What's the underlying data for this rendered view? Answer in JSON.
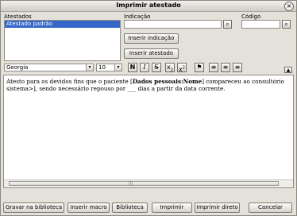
{
  "window": {
    "title": "Imprimir atestado"
  },
  "atestados": {
    "label": "Atestados",
    "items": [
      "Atestado padrão"
    ]
  },
  "indicacao": {
    "label": "Indicação",
    "value": ""
  },
  "codigo": {
    "label": "Código",
    "value": ""
  },
  "actions": {
    "inserir_indicacao": "Inserir indicação",
    "inserir_atestado": "Inserir atestado"
  },
  "toolbar": {
    "font": "Georgia",
    "size": "10",
    "bold": "N",
    "italic": "I",
    "strike": "S"
  },
  "editor": {
    "line1_pre": "Atesto para os devidos fins que o paciente [",
    "line1_bold": "Dados pessoais:Nome",
    "line1_post": "] compareceu ao consultório",
    "line2": "sistema>], sendo necessário repouso por ___ dias a partir da data corrente."
  },
  "footer": {
    "gravar": "Gravar na biblioteca",
    "inserir_macro": "Inserir macro",
    "biblioteca": "Biblioteca",
    "imprimir": "Imprimir",
    "imprimir_direto": "Imprimir direto",
    "cancelar": "Cancelar"
  }
}
